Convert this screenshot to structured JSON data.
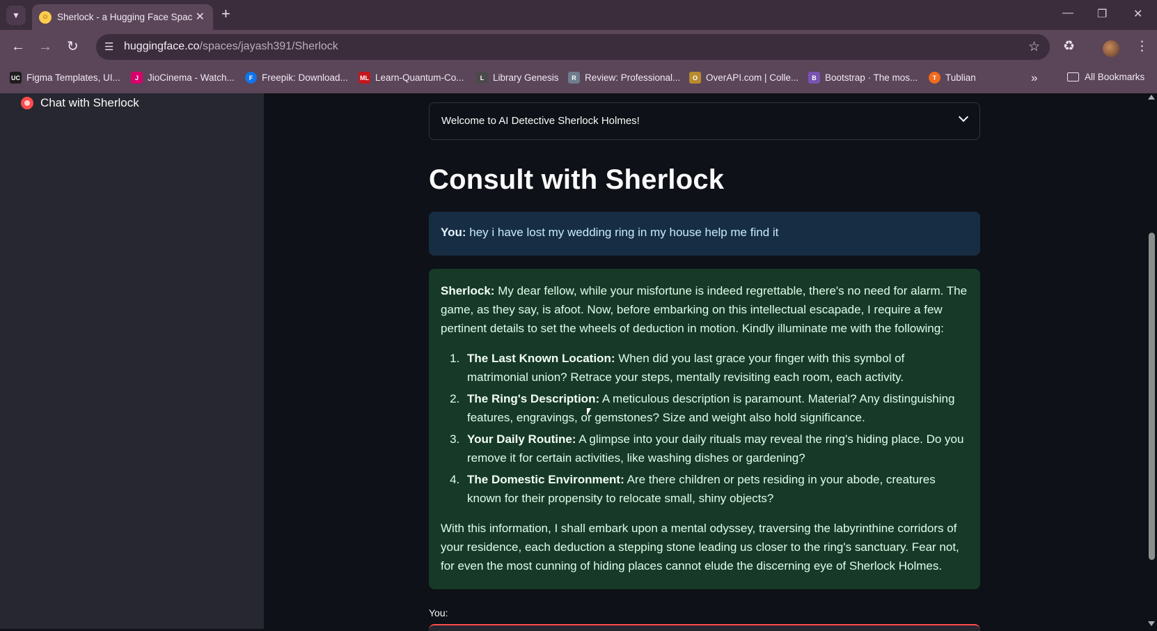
{
  "browser": {
    "tab": {
      "title": "Sherlock - a Hugging Face Spac"
    },
    "url": {
      "host": "huggingface.co",
      "path": "/spaces/jayash391/Sherlock"
    },
    "bookmarks": [
      {
        "label": "Figma Templates, UI...",
        "icon": "UC",
        "color": "#1d1d1d"
      },
      {
        "label": "JioCinema - Watch...",
        "icon": "J",
        "color": "#d9006c"
      },
      {
        "label": "Freepik: Download...",
        "icon": "F",
        "color": "#1273eb"
      },
      {
        "label": "Learn-Quantum-Co...",
        "icon": "ML",
        "color": "#c4161c"
      },
      {
        "label": "Library Genesis",
        "icon": "L",
        "color": "#4a4a4a"
      },
      {
        "label": "Review: Professional...",
        "icon": "R",
        "color": "#6f7c8c"
      },
      {
        "label": "OverAPI.com | Colle...",
        "icon": "O",
        "color": "#b88b2e"
      },
      {
        "label": "Bootstrap · The mos...",
        "icon": "B",
        "color": "#7952b3"
      },
      {
        "label": "Tublian",
        "icon": "T",
        "color": "#f26a1b"
      }
    ],
    "all_bookmarks": "All Bookmarks"
  },
  "sidebar": {
    "item_label": "Chat with Sherlock"
  },
  "main": {
    "expander_label": "Welcome to AI Detective Sherlock Holmes!",
    "title": "Consult with Sherlock",
    "user_message": {
      "speaker": "You:",
      "text": "hey i have lost my wedding ring in my house help me find it"
    },
    "bot_message": {
      "speaker": "Sherlock:",
      "intro": "My dear fellow, while your misfortune is indeed regrettable, there's no need for alarm. The game, as they say, is afoot. Now, before embarking on this intellectual escapade, I require a few pertinent details to set the wheels of deduction in motion. Kindly illuminate me with the following:",
      "items": [
        {
          "heading": "The Last Known Location:",
          "text": "When did you last grace your finger with this symbol of matrimonial union? Retrace your steps, mentally revisiting each room, each activity."
        },
        {
          "heading": "The Ring's Description:",
          "text": "A meticulous description is paramount. Material? Any distinguishing features, engravings, or gemstones? Size and weight also hold significance."
        },
        {
          "heading": "Your Daily Routine:",
          "text": "A glimpse into your daily rituals may reveal the ring's hiding place. Do you remove it for certain activities, like washing dishes or gardening?"
        },
        {
          "heading": "The Domestic Environment:",
          "text": "Are there children or pets residing in your abode, creatures known for their propensity to relocate small, shiny objects?"
        }
      ],
      "outro": "With this information, I shall embark upon a mental odyssey, traversing the labyrinthine corridors of your residence, each deduction a stepping stone leading us closer to the ring's sanctuary. Fear not, for even the most cunning of hiding places cannot elude the discerning eye of Sherlock Holmes."
    },
    "input_label": "You:"
  }
}
